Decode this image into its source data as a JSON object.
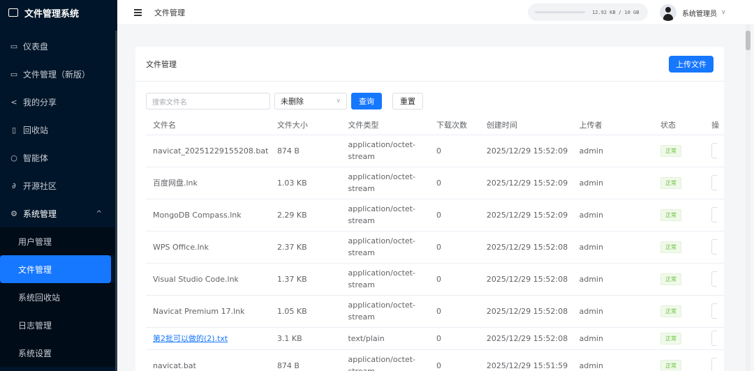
{
  "app": {
    "title": "文件管理系统"
  },
  "sidebar": {
    "items": [
      {
        "icon": "dashboard-icon",
        "glyph": "▭",
        "label": "仪表盘"
      },
      {
        "icon": "folder-icon",
        "glyph": "▭",
        "label": "文件管理（新版）"
      },
      {
        "icon": "share-icon",
        "glyph": "<",
        "label": "我的分享"
      },
      {
        "icon": "trash-icon",
        "glyph": "▯",
        "label": "回收站"
      },
      {
        "icon": "chat-icon",
        "glyph": "○",
        "label": "智能体"
      },
      {
        "icon": "link-icon",
        "glyph": "∂",
        "label": "开源社区"
      }
    ],
    "group": {
      "icon": "gear-icon",
      "glyph": "⚙",
      "label": "系统管理",
      "chevron": "^"
    },
    "sub_items": [
      {
        "label": "用户管理",
        "active": false
      },
      {
        "label": "文件管理",
        "active": true
      },
      {
        "label": "系统回收站",
        "active": false
      },
      {
        "label": "日志管理",
        "active": false
      },
      {
        "label": "系统设置",
        "active": false
      }
    ]
  },
  "header": {
    "breadcrumb": "文件管理",
    "storage_text": "12.92 KB / 10 GB",
    "user_name": "系统管理员",
    "user_chevron": "∨"
  },
  "card": {
    "title": "文件管理",
    "upload_label": "上传文件",
    "search_placeholder": "搜索文件名",
    "filter_value": "未删除",
    "query_label": "查询",
    "reset_label": "重置"
  },
  "table": {
    "columns": [
      "文件名",
      "文件大小",
      "文件类型",
      "下载次数",
      "创建时间",
      "上传者",
      "状态",
      "操"
    ],
    "rows": [
      {
        "name": "navicat_20251229155208.bat",
        "size": "874 B",
        "type": "application/octet-stream",
        "downloads": "0",
        "created": "2025/12/29 15:52:09",
        "uploader": "admin",
        "status": "正常",
        "link": false
      },
      {
        "name": "百度网盘.lnk",
        "size": "1.03 KB",
        "type": "application/octet-stream",
        "downloads": "0",
        "created": "2025/12/29 15:52:09",
        "uploader": "admin",
        "status": "正常",
        "link": false
      },
      {
        "name": "MongoDB Compass.lnk",
        "size": "2.29 KB",
        "type": "application/octet-stream",
        "downloads": "0",
        "created": "2025/12/29 15:52:09",
        "uploader": "admin",
        "status": "正常",
        "link": false
      },
      {
        "name": "WPS Office.lnk",
        "size": "2.37 KB",
        "type": "application/octet-stream",
        "downloads": "0",
        "created": "2025/12/29 15:52:08",
        "uploader": "admin",
        "status": "正常",
        "link": false
      },
      {
        "name": "Visual Studio Code.lnk",
        "size": "1.37 KB",
        "type": "application/octet-stream",
        "downloads": "0",
        "created": "2025/12/29 15:52:08",
        "uploader": "admin",
        "status": "正常",
        "link": false
      },
      {
        "name": "Navicat Premium 17.lnk",
        "size": "1.05 KB",
        "type": "application/octet-stream",
        "downloads": "0",
        "created": "2025/12/29 15:52:08",
        "uploader": "admin",
        "status": "正常",
        "link": false
      },
      {
        "name": "第2批可以做的(2).txt",
        "size": "3.1 KB",
        "type": "text/plain",
        "downloads": "0",
        "created": "2025/12/29 15:52:08",
        "uploader": "admin",
        "status": "正常",
        "link": true
      },
      {
        "name": "navicat.bat",
        "size": "874 B",
        "type": "application/octet-stream",
        "downloads": "0",
        "created": "2025/12/29 15:51:59",
        "uploader": "admin",
        "status": "正常",
        "link": false
      }
    ]
  }
}
